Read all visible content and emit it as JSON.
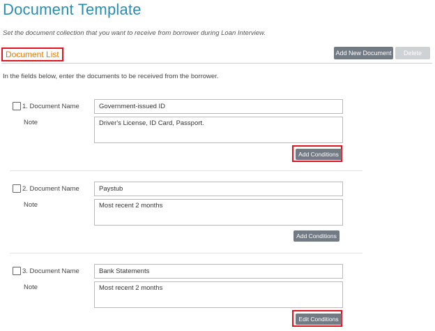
{
  "page": {
    "title": "Document Template",
    "subtitle": "Set the document collection that you want to receive from borrower during Loan Interview.",
    "section_title": "Document List",
    "add_new_document_label": "Add New Document",
    "delete_label": "Delete",
    "instruction": "In the fields below, enter the documents to be received from the borrower."
  },
  "documents": [
    {
      "label": "1. Document Name",
      "name_value": "Government-issued ID",
      "note_label": "Note",
      "note_value": "Driver's License, ID Card, Passport.",
      "conditions_label": "Add Conditions",
      "checked": false
    },
    {
      "label": "2. Document Name",
      "name_value": "Paystub",
      "note_label": "Note",
      "note_value": "Most recent 2 months",
      "conditions_label": "Add Conditions",
      "checked": false
    },
    {
      "label": "3. Document Name",
      "name_value": "Bank Statements",
      "note_label": "Note",
      "note_value": "Most recent 2 months",
      "conditions_label": "Edit Conditions",
      "checked": false
    }
  ],
  "colors": {
    "title": "#2a8dae",
    "section_title": "#e07b00",
    "highlight_border": "#e0141e",
    "button_primary": "#727a84",
    "button_disabled": "#cfd2d5"
  }
}
